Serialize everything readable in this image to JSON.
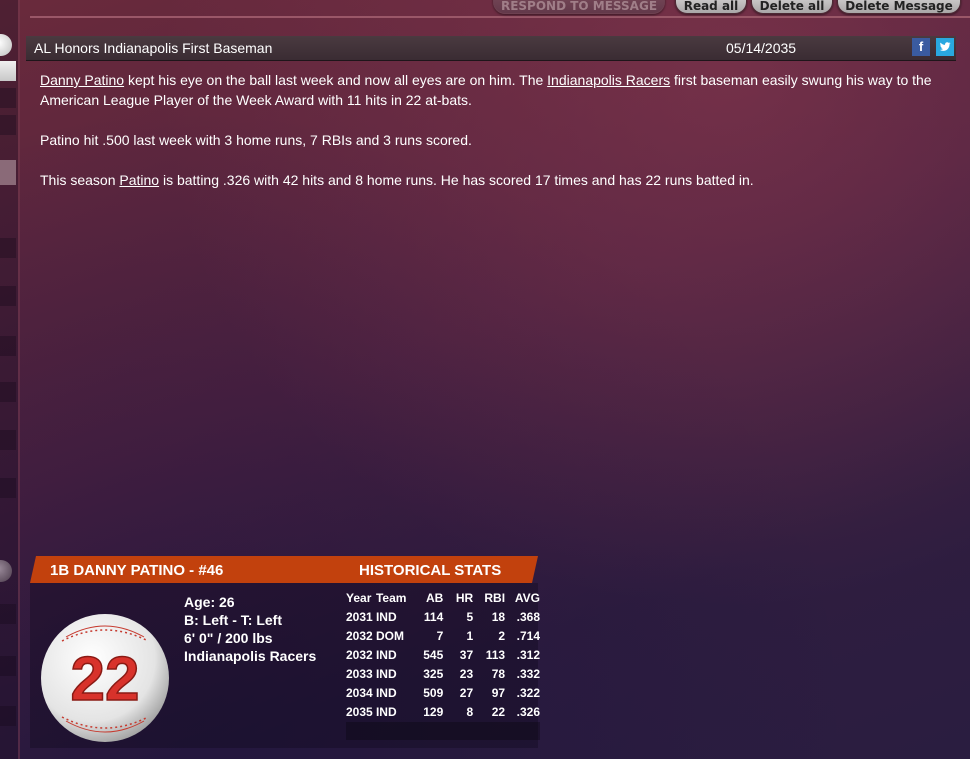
{
  "toolbar": {
    "respond_label": "RESPOND TO MESSAGE",
    "read_all_label": "Read all",
    "delete_all_label": "Delete all",
    "delete_message_label": "Delete Message"
  },
  "message": {
    "title": "AL Honors Indianapolis First Baseman",
    "date": "05/14/2035",
    "facebook_icon": "f",
    "twitter_icon": "twitter-bird",
    "p1": {
      "link1": "Danny Patino",
      "t1": " kept his eye on the ball last week and now all eyes are on him. The ",
      "link2": "Indianapolis Racers",
      "t2": " first baseman easily swung his way to the American League Player of the Week Award with 11 hits in 22 at-bats."
    },
    "p2": "Patino hit .500 last week with 3 home runs, 7 RBIs and 3 runs scored.",
    "p3": {
      "t1": "This season ",
      "link1": "Patino",
      "t2": " is batting .326 with 42 hits and 8 home runs. He has scored 17 times and has 22 runs batted in."
    }
  },
  "player": {
    "header": "1B DANNY PATINO - #46",
    "stats_header": "HISTORICAL STATS",
    "number": "22",
    "age": "Age: 26",
    "bats_throws": "B: Left - T: Left",
    "height_weight": "6' 0\" / 200 lbs",
    "team": "Indianapolis Racers"
  },
  "stats": {
    "columns": [
      "Year",
      "Team",
      "AB",
      "HR",
      "RBI",
      "AVG"
    ],
    "rows": [
      [
        "2031",
        "IND",
        "114",
        "5",
        "18",
        ".368"
      ],
      [
        "2032",
        "DOM",
        "7",
        "1",
        "2",
        ".714"
      ],
      [
        "2032",
        "IND",
        "545",
        "37",
        "113",
        ".312"
      ],
      [
        "2033",
        "IND",
        "325",
        "23",
        "78",
        ".332"
      ],
      [
        "2034",
        "IND",
        "509",
        "27",
        "97",
        ".322"
      ],
      [
        "2035",
        "IND",
        "129",
        "8",
        "22",
        ".326"
      ]
    ]
  },
  "colors": {
    "accent_orange": "#c2410d",
    "ball_number": "#d8322b",
    "facebook": "#3a5ba0",
    "twitter": "#29a8e0"
  }
}
